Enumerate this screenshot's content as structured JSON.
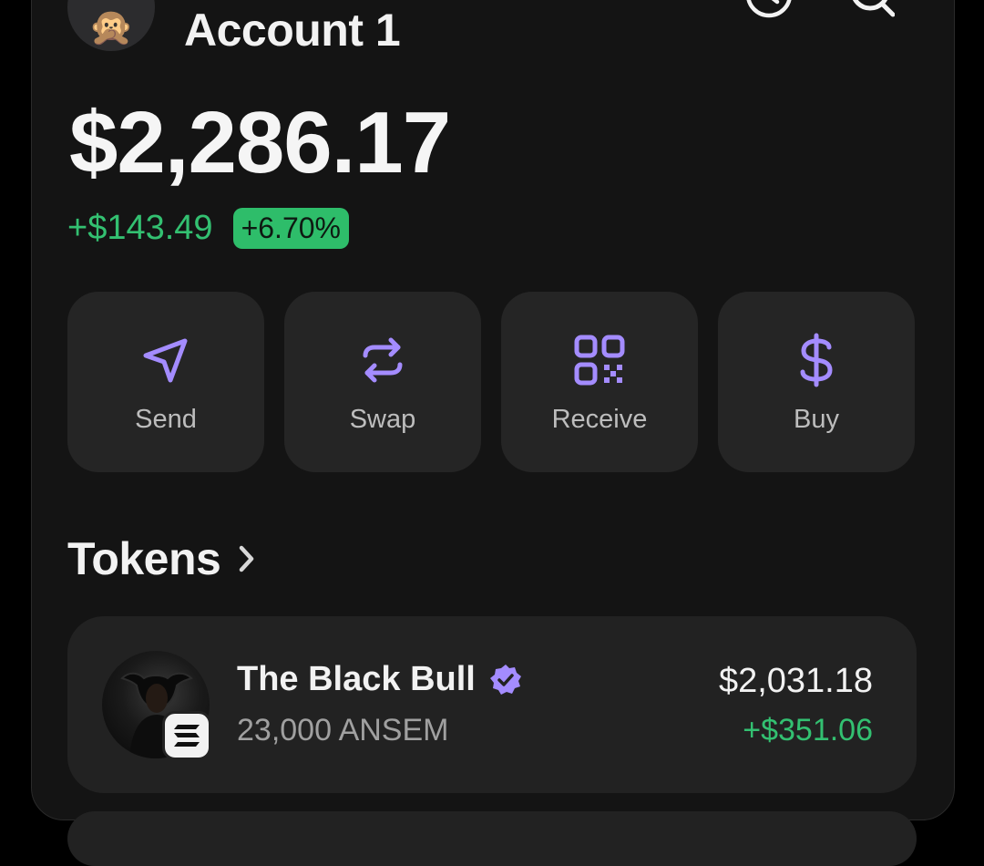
{
  "header": {
    "avatar_emoji": "🙊",
    "account_name": "Account 1",
    "history_icon": "history-clock-icon",
    "search_icon": "search-icon"
  },
  "balance": {
    "total": "$2,286.17",
    "change_amount": "+$143.49",
    "change_percent": "+6.70%"
  },
  "actions": [
    {
      "label": "Send",
      "icon": "send-icon"
    },
    {
      "label": "Swap",
      "icon": "swap-icon"
    },
    {
      "label": "Receive",
      "icon": "qr-code-icon"
    },
    {
      "label": "Buy",
      "icon": "dollar-icon"
    }
  ],
  "tokens_section": {
    "title": "Tokens"
  },
  "tokens": [
    {
      "name": "The Black Bull",
      "verified": true,
      "amount": "23,000 ANSEM",
      "value": "$2,031.18",
      "change": "+$351.06"
    }
  ],
  "colors": {
    "accent": "#a48cff",
    "positive": "#33c071",
    "background": "#141414",
    "card": "#252525"
  }
}
